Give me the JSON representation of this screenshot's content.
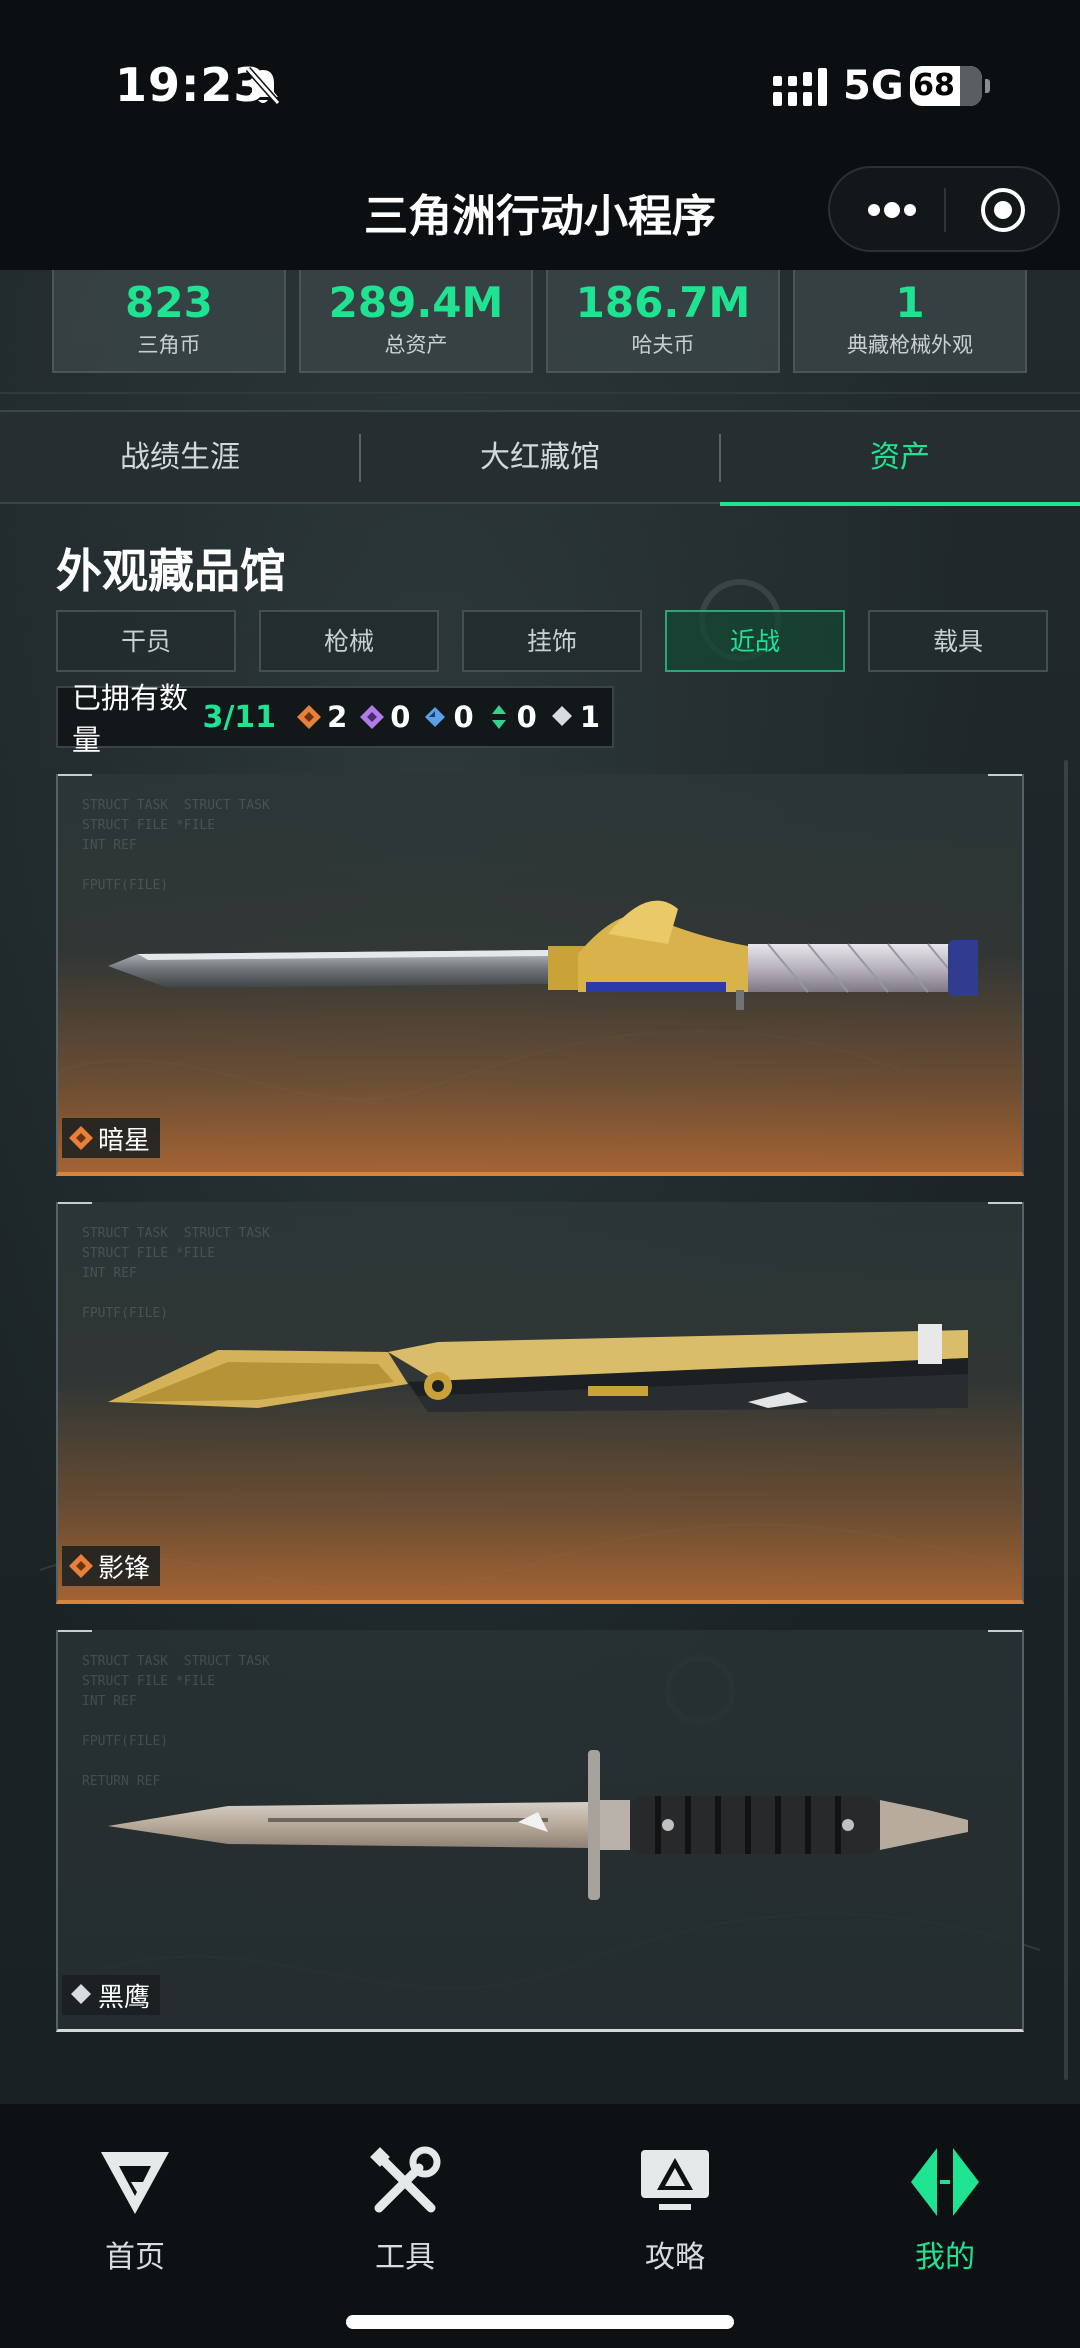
{
  "status_bar": {
    "time": "19:23",
    "network": "5G",
    "battery": "68"
  },
  "header": {
    "title": "三角洲行动小程序"
  },
  "stats": [
    {
      "value": "823",
      "label": "三角币"
    },
    {
      "value": "289.4M",
      "label": "总资产"
    },
    {
      "value": "186.7M",
      "label": "哈夫币"
    },
    {
      "value": "1",
      "label": "典藏枪械外观"
    }
  ],
  "tabs": [
    {
      "label": "战绩生涯",
      "active": false
    },
    {
      "label": "大红藏馆",
      "active": false
    },
    {
      "label": "资产",
      "active": true
    }
  ],
  "collection": {
    "title": "外观藏品馆",
    "categories": [
      {
        "label": "干员",
        "active": false
      },
      {
        "label": "枪械",
        "active": false
      },
      {
        "label": "挂饰",
        "active": false
      },
      {
        "label": "近战",
        "active": true
      },
      {
        "label": "载具",
        "active": false
      }
    ],
    "owned_label": "已拥有数量",
    "owned_count": "3/11",
    "rarity_counts": [
      {
        "icon": "orange-diamond-icon",
        "color": "#e8803a",
        "count": "2"
      },
      {
        "icon": "purple-diamond-icon",
        "color": "#b07ce8",
        "count": "0"
      },
      {
        "icon": "blue-diamond-icon",
        "color": "#5aa0e8",
        "count": "0"
      },
      {
        "icon": "green-arrows-icon",
        "color": "#34d28a",
        "count": "0"
      },
      {
        "icon": "white-diamond-icon",
        "color": "#d8dcde",
        "count": "1"
      }
    ],
    "items": [
      {
        "name": "暗星",
        "rarity": "gold",
        "icon": "orange-diamond-icon"
      },
      {
        "name": "影锋",
        "rarity": "gold",
        "icon": "orange-diamond-icon"
      },
      {
        "name": "黑鹰",
        "rarity": "white",
        "icon": "white-diamond-icon"
      }
    ]
  },
  "bottom_nav": [
    {
      "label": "首页",
      "icon": "delta-logo-icon",
      "active": false
    },
    {
      "label": "工具",
      "icon": "tools-icon",
      "active": false
    },
    {
      "label": "攻略",
      "icon": "guide-monitor-icon",
      "active": false
    },
    {
      "label": "我的",
      "icon": "profile-emblem-icon",
      "active": true
    }
  ],
  "colors": {
    "accent": "#1ee492",
    "gold_rarity": "#d6843e",
    "background": "#1a2123"
  }
}
